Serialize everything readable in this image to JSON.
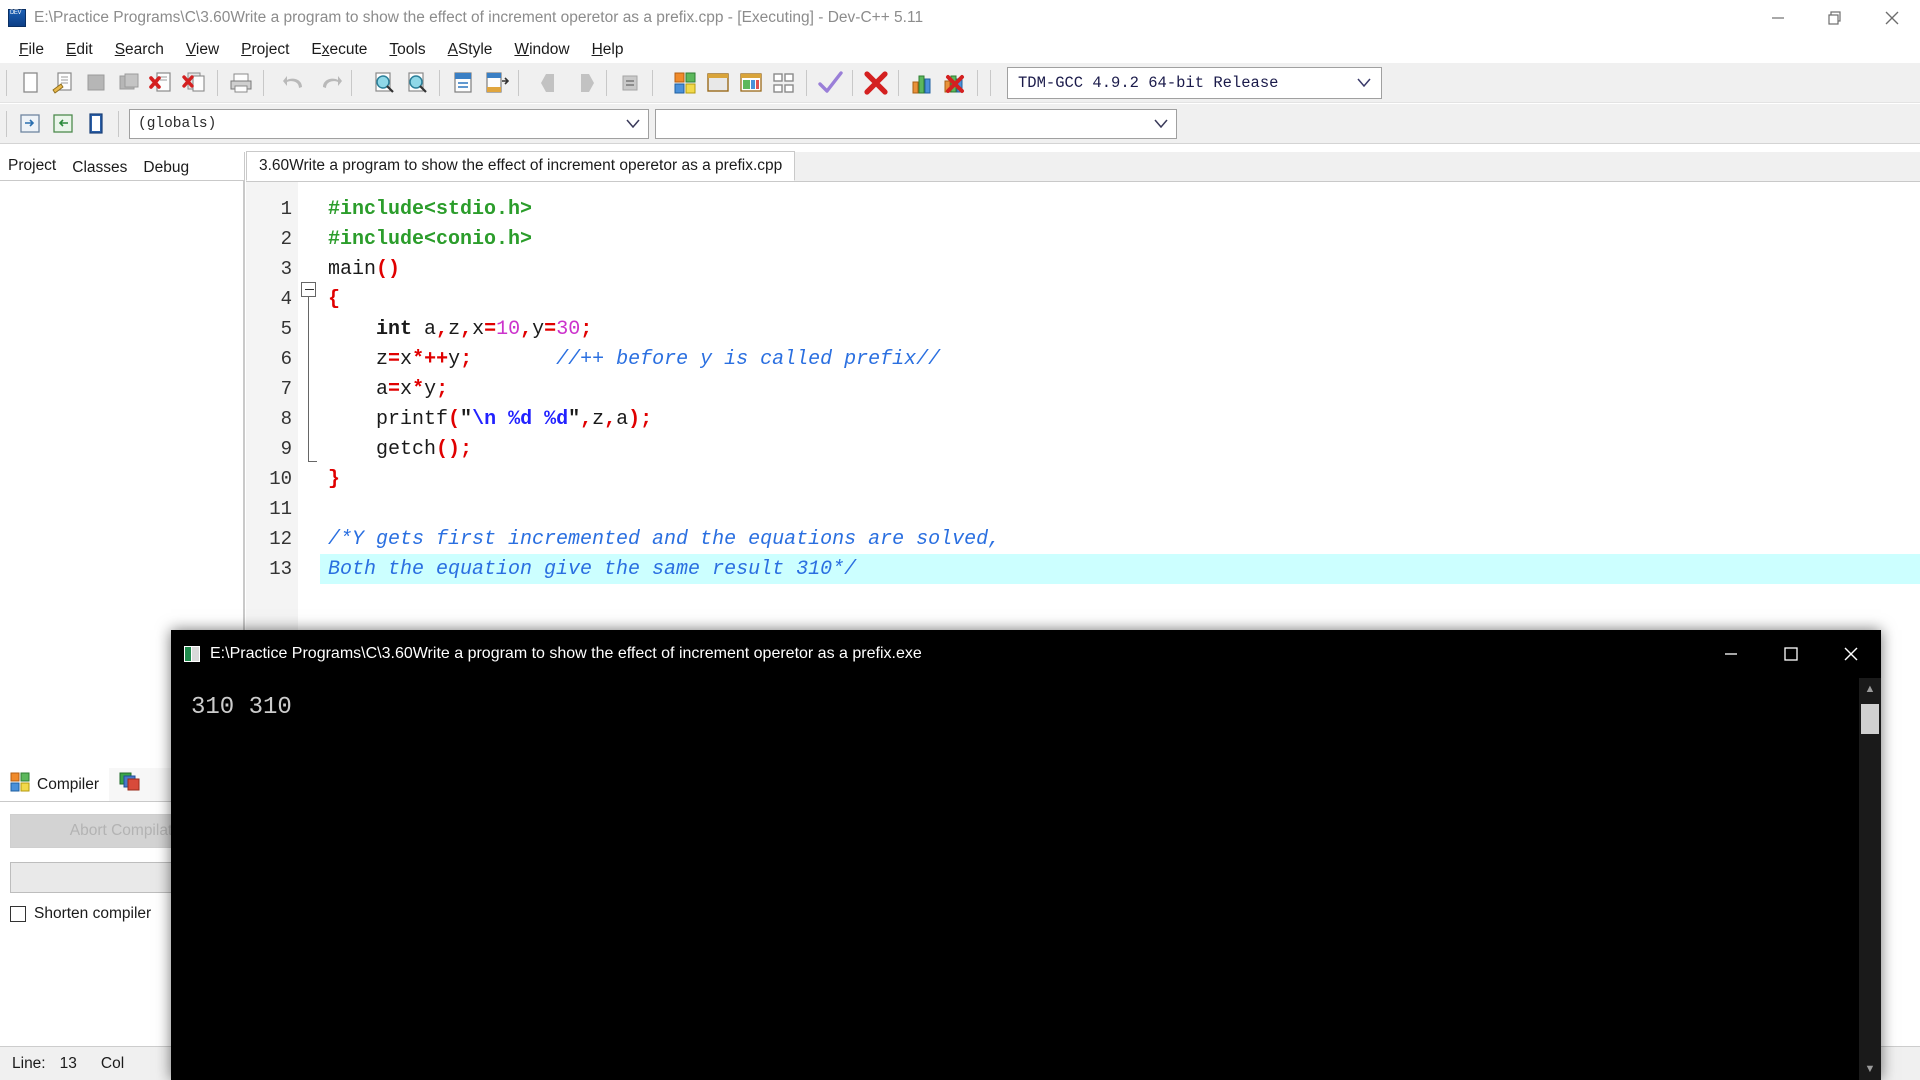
{
  "window": {
    "title": "E:\\Practice Programs\\C\\3.60Write a program to show the effect of increment operetor as a prefix.cpp - [Executing] - Dev-C++ 5.11",
    "minimize_label": "—",
    "maximize_label": "❐",
    "close_label": "✕"
  },
  "menu": [
    {
      "label": "File",
      "accel": "F"
    },
    {
      "label": "Edit",
      "accel": "E"
    },
    {
      "label": "Search",
      "accel": "S"
    },
    {
      "label": "View",
      "accel": "V"
    },
    {
      "label": "Project",
      "accel": "P"
    },
    {
      "label": "Execute",
      "accel": "x"
    },
    {
      "label": "Tools",
      "accel": "T"
    },
    {
      "label": "AStyle",
      "accel": "A"
    },
    {
      "label": "Window",
      "accel": "W"
    },
    {
      "label": "Help",
      "accel": "H"
    }
  ],
  "toolbar": {
    "compiler_select_value": "TDM-GCC 4.9.2 64-bit Release",
    "icons": [
      "new-file-icon",
      "open-file-icon",
      "save-file-icon",
      "save-all-icon",
      "close-file-icon",
      "close-all-icon",
      "print-icon",
      "undo-icon",
      "redo-icon",
      "find-icon",
      "replace-icon",
      "goto-line-icon",
      "goto-function-icon",
      "back-icon",
      "forward-icon",
      "toggle-breakpoint-icon",
      "compile-icon",
      "run-icon",
      "compile-and-run-icon",
      "rebuild-all-icon",
      "syntax-check-icon",
      "stop-execution-icon",
      "profile-analysis-icon",
      "delete-profile-icon"
    ]
  },
  "toolbar2": {
    "scope_combo_value": "(globals)",
    "member_combo_value": "",
    "icons": [
      "insert-icon",
      "toggle-icon",
      "goto-class-icon"
    ]
  },
  "left_panel": {
    "tabs": [
      {
        "label": "Project",
        "active": true
      },
      {
        "label": "Classes",
        "active": false
      },
      {
        "label": "Debug",
        "active": false
      }
    ]
  },
  "compiler_panel": {
    "tabs": [
      {
        "label": "Compiler",
        "icon": "compiler-grid-icon",
        "selected": true
      },
      {
        "label": "",
        "icon": "resources-icon",
        "selected": false
      }
    ],
    "abort_button": "Abort Compilat",
    "progress_value": "",
    "shorten_checkbox_label": "Shorten compiler",
    "shorten_checked": false
  },
  "status_bar": {
    "line_label": "Line:",
    "line_value": "13",
    "col_label": "Col"
  },
  "editor": {
    "tab_label": "3.60Write a program to show the effect of increment operetor as a prefix.cpp",
    "line_numbers": [
      "1",
      "2",
      "3",
      "4",
      "5",
      "6",
      "7",
      "8",
      "9",
      "10",
      "11",
      "12",
      "13"
    ],
    "lines": [
      {
        "n": 1,
        "highlight": false,
        "tokens": [
          {
            "t": "#include<stdio.h>",
            "c": "tok-pre"
          }
        ]
      },
      {
        "n": 2,
        "highlight": false,
        "tokens": [
          {
            "t": "#include<conio.h>",
            "c": "tok-pre"
          }
        ]
      },
      {
        "n": 3,
        "highlight": false,
        "tokens": [
          {
            "t": "main",
            "c": "tok-id"
          },
          {
            "t": "()",
            "c": "tok-sym"
          }
        ]
      },
      {
        "n": 4,
        "highlight": false,
        "tokens": [
          {
            "t": "{",
            "c": "tok-brace"
          }
        ]
      },
      {
        "n": 5,
        "highlight": false,
        "tokens": [
          {
            "t": "    ",
            "c": "tok-id"
          },
          {
            "t": "int",
            "c": "tok-kw"
          },
          {
            "t": " a",
            "c": "tok-id"
          },
          {
            "t": ",",
            "c": "tok-sym"
          },
          {
            "t": "z",
            "c": "tok-id"
          },
          {
            "t": ",",
            "c": "tok-sym"
          },
          {
            "t": "x",
            "c": "tok-id"
          },
          {
            "t": "=",
            "c": "tok-sym"
          },
          {
            "t": "10",
            "c": "tok-num"
          },
          {
            "t": ",",
            "c": "tok-sym"
          },
          {
            "t": "y",
            "c": "tok-id"
          },
          {
            "t": "=",
            "c": "tok-sym"
          },
          {
            "t": "30",
            "c": "tok-num"
          },
          {
            "t": ";",
            "c": "tok-sym"
          }
        ]
      },
      {
        "n": 6,
        "highlight": false,
        "tokens": [
          {
            "t": "    ",
            "c": "tok-id"
          },
          {
            "t": "z",
            "c": "tok-id"
          },
          {
            "t": "=",
            "c": "tok-sym"
          },
          {
            "t": "x",
            "c": "tok-id"
          },
          {
            "t": "*++",
            "c": "tok-sym"
          },
          {
            "t": "y",
            "c": "tok-id"
          },
          {
            "t": ";",
            "c": "tok-sym"
          },
          {
            "t": "       ",
            "c": "tok-id"
          },
          {
            "t": "//++ before y is called prefix//",
            "c": "tok-cmt"
          }
        ]
      },
      {
        "n": 7,
        "highlight": false,
        "tokens": [
          {
            "t": "    ",
            "c": "tok-id"
          },
          {
            "t": "a",
            "c": "tok-id"
          },
          {
            "t": "=",
            "c": "tok-sym"
          },
          {
            "t": "x",
            "c": "tok-id"
          },
          {
            "t": "*",
            "c": "tok-sym"
          },
          {
            "t": "y",
            "c": "tok-id"
          },
          {
            "t": ";",
            "c": "tok-sym"
          }
        ]
      },
      {
        "n": 8,
        "highlight": false,
        "tokens": [
          {
            "t": "    ",
            "c": "tok-id"
          },
          {
            "t": "printf",
            "c": "tok-id"
          },
          {
            "t": "(",
            "c": "tok-sym"
          },
          {
            "t": "\"",
            "c": "tok-str"
          },
          {
            "t": "\\n %d %d",
            "c": "tok-esc"
          },
          {
            "t": "\"",
            "c": "tok-str"
          },
          {
            "t": ",",
            "c": "tok-sym"
          },
          {
            "t": "z",
            "c": "tok-id"
          },
          {
            "t": ",",
            "c": "tok-sym"
          },
          {
            "t": "a",
            "c": "tok-id"
          },
          {
            "t": ");",
            "c": "tok-sym"
          }
        ]
      },
      {
        "n": 9,
        "highlight": false,
        "tokens": [
          {
            "t": "    ",
            "c": "tok-id"
          },
          {
            "t": "getch",
            "c": "tok-id"
          },
          {
            "t": "();",
            "c": "tok-sym"
          }
        ]
      },
      {
        "n": 10,
        "highlight": false,
        "tokens": [
          {
            "t": "}",
            "c": "tok-brace"
          }
        ]
      },
      {
        "n": 11,
        "highlight": false,
        "tokens": [
          {
            "t": "",
            "c": "tok-id"
          }
        ]
      },
      {
        "n": 12,
        "highlight": false,
        "tokens": [
          {
            "t": "/*Y gets first incremented and the equations are solved,",
            "c": "tok-cmt"
          }
        ]
      },
      {
        "n": 13,
        "highlight": true,
        "tokens": [
          {
            "t": "Both the equation give the same result 310*/",
            "c": "tok-cmt"
          }
        ]
      }
    ]
  },
  "console": {
    "title": "E:\\Practice Programs\\C\\3.60Write a program to show the effect of increment operetor as a prefix.exe",
    "output": "310 310",
    "minimize_label": "—",
    "maximize_label": "□",
    "close_label": "✕",
    "scroll_up": "▲",
    "scroll_down": "▼"
  },
  "colors": {
    "highlight": "#ccffff",
    "comment": "#2a6fe0",
    "preprocessor": "#2b9d2b",
    "symbol": "#e00000",
    "number": "#cc33cc",
    "console_bg": "#000000",
    "console_fg": "#cccccc"
  }
}
